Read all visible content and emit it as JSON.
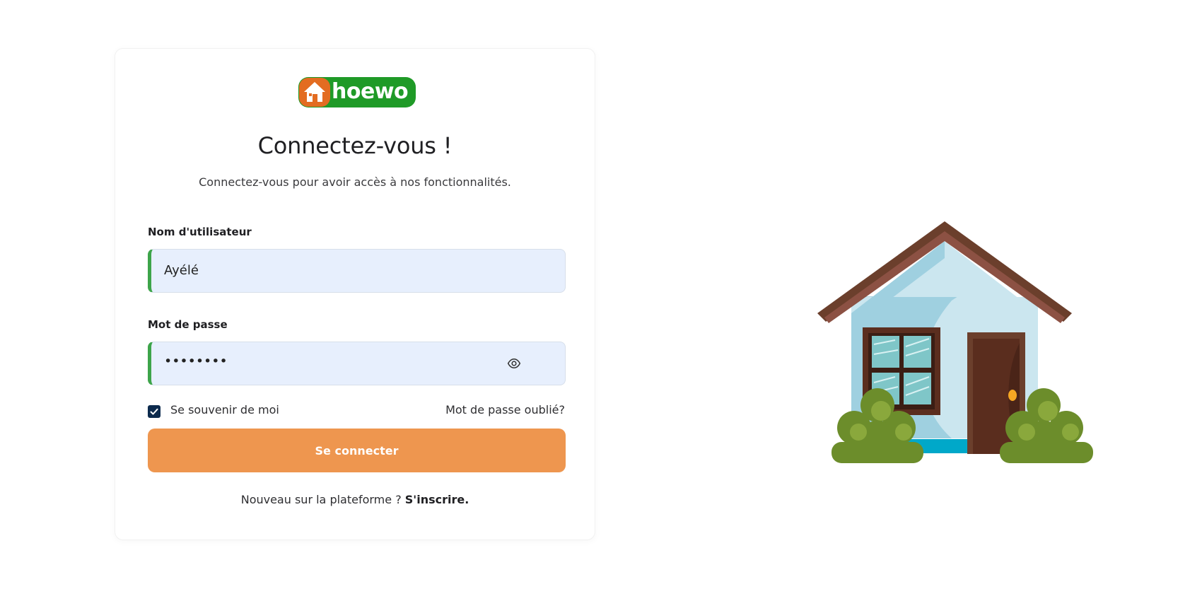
{
  "brand": {
    "name": "hoewo",
    "colors": {
      "green": "#1f9a27",
      "orange": "#e36c21"
    }
  },
  "heading": {
    "title": "Connectez-vous !",
    "subtitle": "Connectez-vous pour avoir accès à nos fonctionnalités."
  },
  "form": {
    "username": {
      "label": "Nom d'utilisateur",
      "value": "Ayélé"
    },
    "password": {
      "label": "Mot de passe",
      "value": "••••••••",
      "toggle_icon": "eye-icon"
    },
    "remember": {
      "label": "Se souvenir de moi",
      "checked": true
    },
    "forgot_label": "Mot de passe oublié?",
    "submit_label": "Se connecter",
    "signup_prompt": "Nouveau sur la plateforme ?",
    "signup_link": "S'inscrire."
  },
  "illustration": {
    "icon": "house-illustration"
  },
  "colors": {
    "accent": "#ee964f",
    "field_bg": "#e7effd",
    "field_border_left": "#3da44a",
    "checkbox": "#0c2a4d"
  }
}
